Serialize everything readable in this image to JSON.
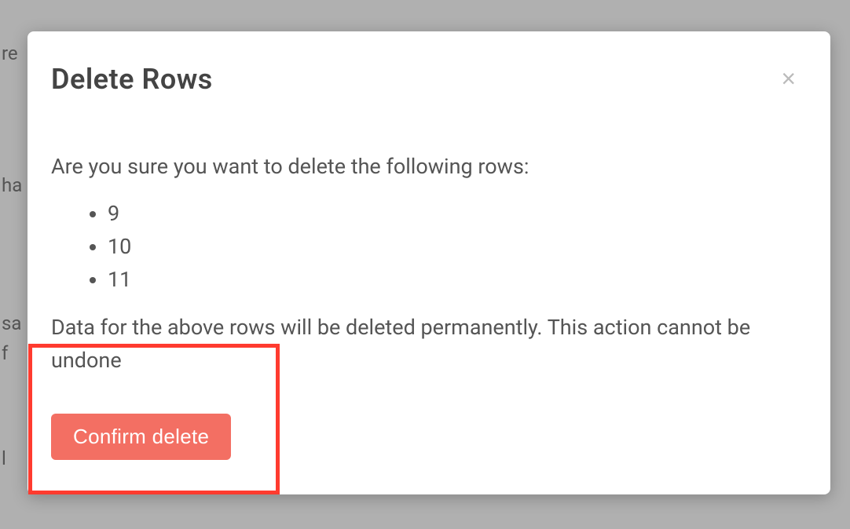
{
  "modal": {
    "title": "Delete Rows",
    "prompt": "Are you sure you want to delete the following rows:",
    "rows": [
      "9",
      "10",
      "11"
    ],
    "warning": "Data for the above rows will be deleted permanently. This action cannot be undone",
    "confirm_label": "Confirm delete",
    "close_symbol": "×"
  },
  "background": {
    "fragments": [
      "re",
      "ha",
      "sa",
      "f",
      "l"
    ]
  }
}
